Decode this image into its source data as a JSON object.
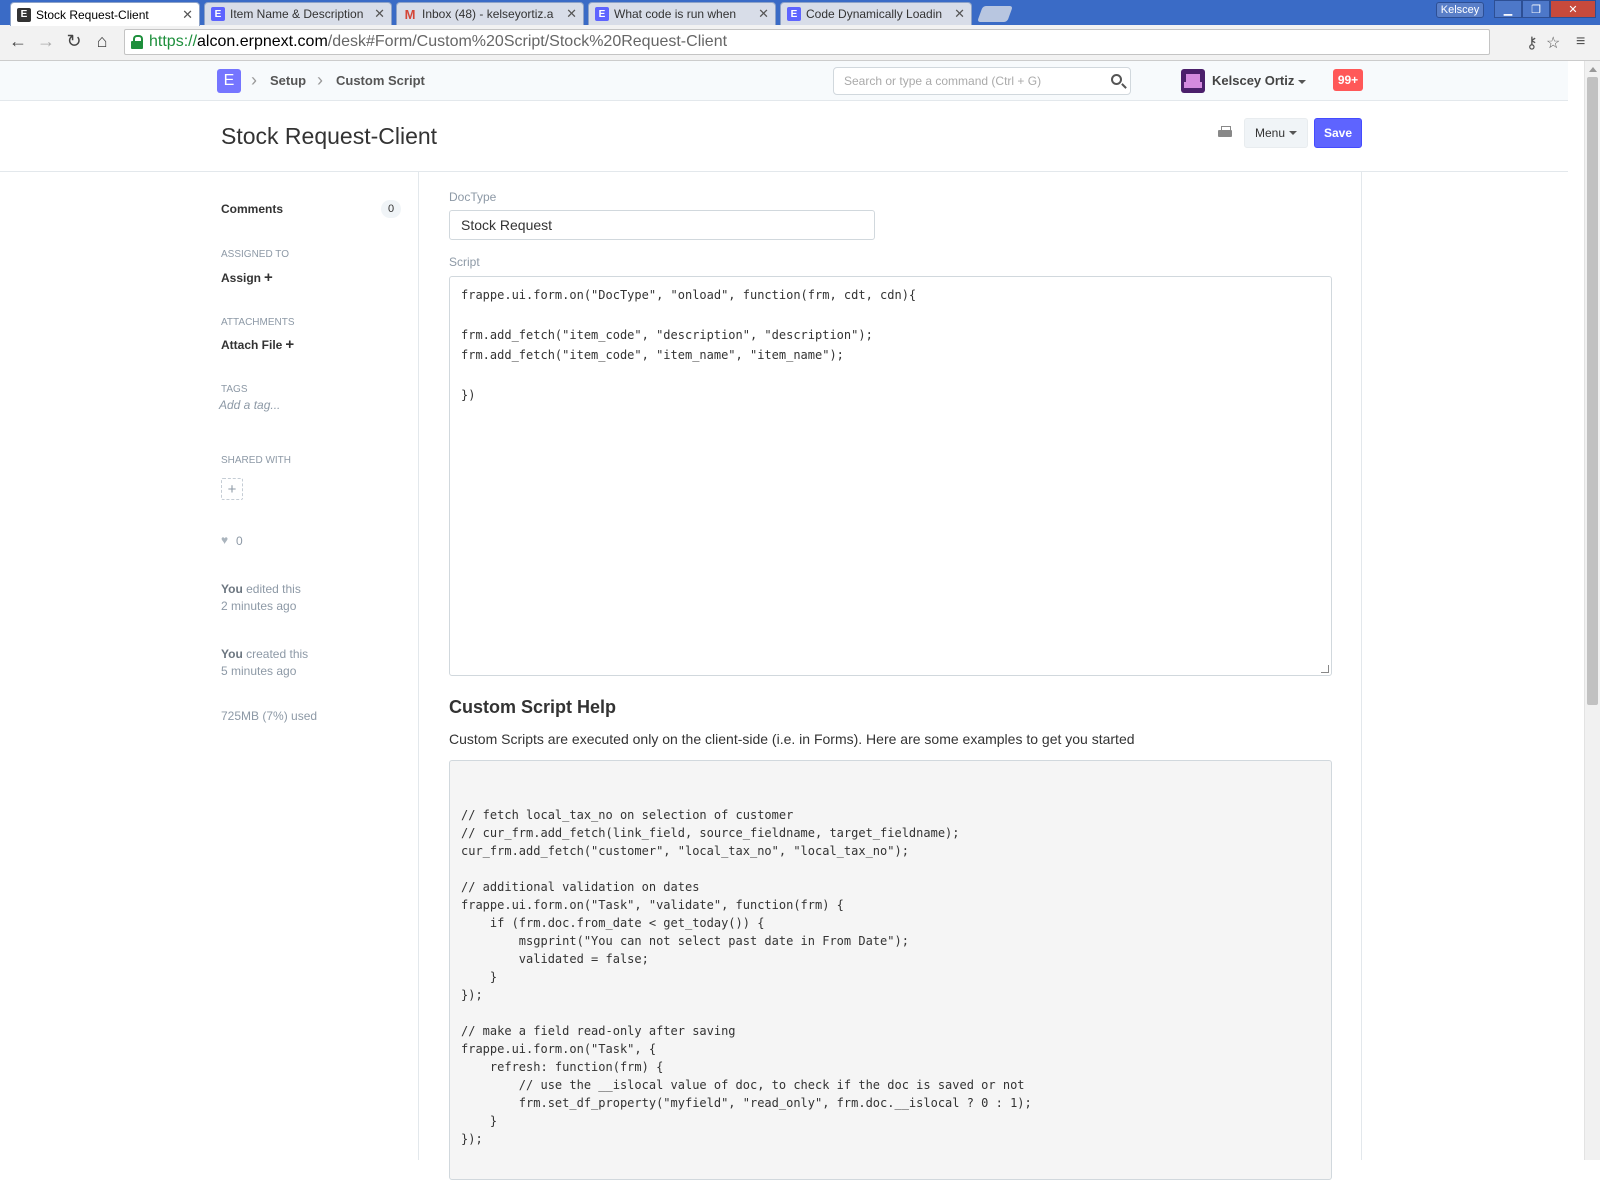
{
  "browser": {
    "tabs": [
      {
        "title": "Stock Request-Client",
        "icon": "E",
        "active": true
      },
      {
        "title": "Item Name & Description",
        "icon": "E",
        "active": false
      },
      {
        "title": "Inbox (48) - kelseyortiz.a",
        "icon": "M",
        "active": false
      },
      {
        "title": "What code is run when",
        "icon": "E",
        "active": false
      },
      {
        "title": "Code Dynamically Loadin",
        "icon": "E",
        "active": false
      }
    ],
    "profile_name": "Kelscey",
    "url": {
      "scheme": "https://",
      "host": "alcon.erpnext.com",
      "path": "/desk#Form/Custom%20Script/Stock%20Request-Client"
    }
  },
  "navbar": {
    "logo_letter": "E",
    "breadcrumbs": [
      "Setup",
      "Custom Script"
    ],
    "search_placeholder": "Search or type a command (Ctrl + G)",
    "user_name": "Kelscey Ortiz",
    "notification_count": "99+"
  },
  "page": {
    "title": "Stock Request-Client",
    "menu_label": "Menu",
    "save_label": "Save"
  },
  "sidebar": {
    "comments_label": "Comments",
    "comments_count": "0",
    "assigned_to_label": "ASSIGNED TO",
    "assign_label": "Assign",
    "attachments_label": "ATTACHMENTS",
    "attach_label": "Attach File",
    "tags_label": "TAGS",
    "add_tag_placeholder": "Add a tag...",
    "shared_with_label": "SHARED WITH",
    "likes_count": "0",
    "activity": [
      {
        "who": "You",
        "what": "edited this",
        "when": "2 minutes ago"
      },
      {
        "who": "You",
        "what": "created this",
        "when": "5 minutes ago"
      }
    ],
    "usage": "725MB (7%) used"
  },
  "form": {
    "doctype_label": "DocType",
    "doctype_value": "Stock Request",
    "script_label": "Script",
    "script_value": "frappe.ui.form.on(\"DocType\", \"onload\", function(frm, cdt, cdn){\n\nfrm.add_fetch(\"item_code\", \"description\", \"description\");\nfrm.add_fetch(\"item_code\", \"item_name\", \"item_name\");\n\n})",
    "help_title": "Custom Script Help",
    "help_description": "Custom Scripts are executed only on the client-side (i.e. in Forms). Here are some examples to get you started",
    "help_code": "// fetch local_tax_no on selection of customer\n// cur_frm.add_fetch(link_field, source_fieldname, target_fieldname);\ncur_frm.add_fetch(\"customer\", \"local_tax_no\", \"local_tax_no\");\n\n// additional validation on dates\nfrappe.ui.form.on(\"Task\", \"validate\", function(frm) {\n    if (frm.doc.from_date < get_today()) {\n        msgprint(\"You can not select past date in From Date\");\n        validated = false;\n    }\n});\n\n// make a field read-only after saving\nfrappe.ui.form.on(\"Task\", {\n    refresh: function(frm) {\n        // use the __islocal value of doc, to check if the doc is saved or not\n        frm.set_df_property(\"myfield\", \"read_only\", frm.doc.__islocal ? 0 : 1);\n    }\n});"
  },
  "colors": {
    "accent": "#5e64ff",
    "notification": "#ff5858",
    "secure_green": "#1e8f3c"
  }
}
